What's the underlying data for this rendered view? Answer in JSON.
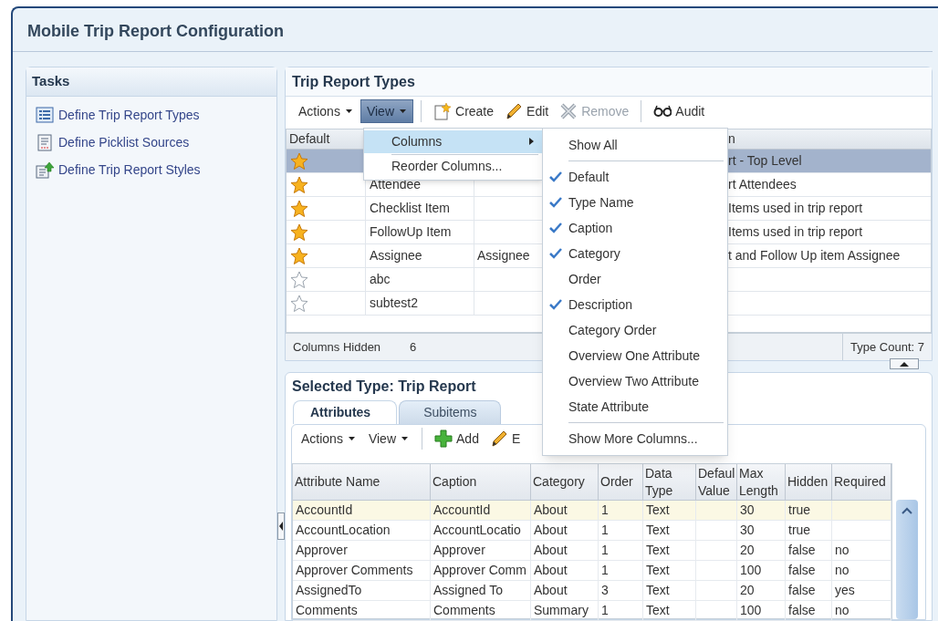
{
  "window": {
    "title": "Mobile Trip Report Configuration"
  },
  "tasks": {
    "title": "Tasks",
    "items": [
      {
        "label": "Define Trip Report Types",
        "kind": "list"
      },
      {
        "label": "Define Picklist Sources",
        "kind": "document"
      },
      {
        "label": "Define Trip Report Styles",
        "kind": "upload"
      }
    ]
  },
  "trip_report_types": {
    "title": "Trip Report Types",
    "toolbar": [
      {
        "label": "Actions",
        "kind": "menu",
        "selected": false
      },
      {
        "label": "View",
        "kind": "menu",
        "selected": true
      },
      {
        "label": "Create",
        "kind": "create",
        "disabled": false
      },
      {
        "label": "Edit",
        "kind": "edit",
        "disabled": false
      },
      {
        "label": "Remove",
        "kind": "remove",
        "disabled": true
      },
      {
        "label": "Audit",
        "kind": "audit",
        "disabled": false
      }
    ],
    "columns": [
      "Default",
      "n"
    ],
    "rows": [
      {
        "default": true,
        "selected": true,
        "description": "rt - Top Level"
      },
      {
        "default": true,
        "selected": false,
        "type_name": "Attendee",
        "description": "rt Attendees"
      },
      {
        "default": true,
        "selected": false,
        "type_name": "Checklist Item",
        "description": "Items used in trip report"
      },
      {
        "default": true,
        "selected": false,
        "type_name": "FollowUp Item",
        "description": "Items used in trip report"
      },
      {
        "default": true,
        "selected": false,
        "type_name": "Assignee",
        "caption": "Assignee",
        "description": "t and Follow Up item Assignee"
      },
      {
        "default": false,
        "selected": false,
        "type_name": "abc"
      },
      {
        "default": false,
        "selected": false,
        "type_name": "subtest2"
      }
    ],
    "footer": {
      "columns_hidden_label": "Columns Hidden",
      "columns_hidden_value": "6",
      "type_count": "Type Count: 7"
    }
  },
  "view_menu": {
    "items": [
      {
        "label": "Columns",
        "selected": true,
        "submenu": true
      },
      {
        "label": "Reorder Columns...",
        "selected": false,
        "submenu": false
      }
    ]
  },
  "columns_submenu": {
    "items": [
      {
        "label": "Show All",
        "kind": "command",
        "checked": false
      },
      {
        "label": "Default",
        "kind": "column",
        "checked": true
      },
      {
        "label": "Type Name",
        "kind": "column",
        "checked": true
      },
      {
        "label": "Caption",
        "kind": "column",
        "checked": true
      },
      {
        "label": "Category",
        "kind": "column",
        "checked": true
      },
      {
        "label": "Order",
        "kind": "column",
        "checked": false
      },
      {
        "label": "Description",
        "kind": "column",
        "checked": true
      },
      {
        "label": "Category Order",
        "kind": "column",
        "checked": false
      },
      {
        "label": "Overview One Attribute",
        "kind": "column",
        "checked": false
      },
      {
        "label": "Overview Two Attribute",
        "kind": "column",
        "checked": false
      },
      {
        "label": "State Attribute",
        "kind": "column",
        "checked": false
      },
      {
        "label": "Show More Columns...",
        "kind": "command",
        "checked": false
      }
    ]
  },
  "selected_type": {
    "title": "Selected Type: Trip Report",
    "tabs": [
      {
        "label": "Attributes",
        "selected": true
      },
      {
        "label": "Subitems",
        "selected": false
      }
    ],
    "toolbar": [
      {
        "label": "Actions",
        "kind": "menu"
      },
      {
        "label": "View",
        "kind": "menu"
      },
      {
        "label": "Add",
        "kind": "add"
      },
      {
        "label": "E",
        "kind": "edit"
      }
    ],
    "columns": [
      "Attribute Name",
      "Caption",
      "Category",
      "Order",
      "Data Type",
      "Defaul Value",
      "Max Length",
      "Hidden",
      "Required"
    ],
    "rows": [
      {
        "selected": true,
        "cells": [
          "AccountId",
          "AccountId",
          "About",
          "1",
          "Text",
          null,
          "30",
          "true",
          null
        ]
      },
      {
        "selected": false,
        "cells": [
          "AccountLocation",
          "AccountLocatio",
          "About",
          "1",
          "Text",
          null,
          "30",
          "true",
          null
        ]
      },
      {
        "selected": false,
        "cells": [
          "Approver",
          "Approver",
          "About",
          "1",
          "Text",
          null,
          "20",
          "false",
          "no"
        ]
      },
      {
        "selected": false,
        "cells": [
          "Approver Comments",
          "Approver Comm",
          "About",
          "1",
          "Text",
          null,
          "100",
          "false",
          "no"
        ]
      },
      {
        "selected": false,
        "cells": [
          "AssignedTo",
          "Assigned To",
          "About",
          "3",
          "Text",
          null,
          "20",
          "false",
          "yes"
        ]
      },
      {
        "selected": false,
        "cells": [
          "Comments",
          "Comments",
          "Summary",
          "1",
          "Text",
          null,
          "100",
          "false",
          "no"
        ]
      }
    ]
  }
}
